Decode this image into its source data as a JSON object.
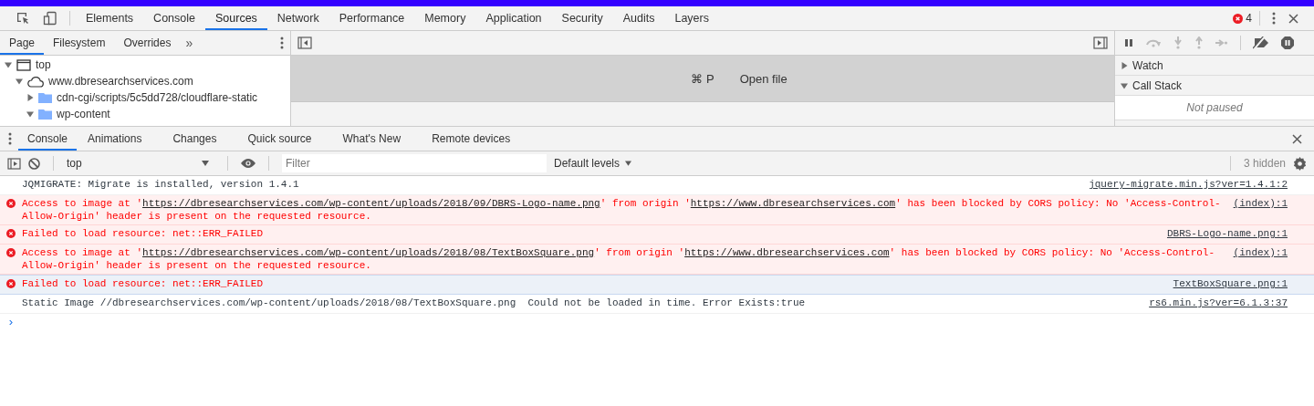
{
  "main_tabs": [
    {
      "label": "Elements",
      "selected": false
    },
    {
      "label": "Console",
      "selected": false
    },
    {
      "label": "Sources",
      "selected": true
    },
    {
      "label": "Network",
      "selected": false
    },
    {
      "label": "Performance",
      "selected": false
    },
    {
      "label": "Memory",
      "selected": false
    },
    {
      "label": "Application",
      "selected": false
    },
    {
      "label": "Security",
      "selected": false
    },
    {
      "label": "Audits",
      "selected": false
    },
    {
      "label": "Layers",
      "selected": false
    }
  ],
  "error_count": "4",
  "navigator_tabs": [
    {
      "label": "Page",
      "selected": true
    },
    {
      "label": "Filesystem",
      "selected": false
    },
    {
      "label": "Overrides",
      "selected": false
    }
  ],
  "navigator_more": "»",
  "file_tree": [
    {
      "label": "top",
      "kind": "frame",
      "expanded": true,
      "children": [
        {
          "label": "www.dbresearchservices.com",
          "kind": "domain",
          "expanded": true,
          "children": [
            {
              "label": "cdn-cgi/scripts/5c5dd728/cloudflare-static",
              "kind": "folder",
              "expanded": false
            },
            {
              "label": "wp-content",
              "kind": "folder",
              "expanded": true
            }
          ]
        }
      ]
    }
  ],
  "editor": {
    "shortcut": "⌘ P",
    "action": "Open file"
  },
  "debugger_sections": [
    {
      "label": "Watch",
      "expanded": false
    },
    {
      "label": "Call Stack",
      "expanded": true,
      "content": "Not paused"
    }
  ],
  "drawer_tabs": [
    {
      "label": "Console",
      "selected": true
    },
    {
      "label": "Animations",
      "selected": false
    },
    {
      "label": "Changes",
      "selected": false
    },
    {
      "label": "Quick source",
      "selected": false
    },
    {
      "label": "What's New",
      "selected": false
    },
    {
      "label": "Remote devices",
      "selected": false
    }
  ],
  "console_toolbar": {
    "context": "top",
    "filter_placeholder": "Filter",
    "levels": "Default levels",
    "hidden_count": "3 hidden"
  },
  "messages": [
    {
      "kind": "log",
      "selected": false,
      "parts": [
        {
          "text": "JQMIGRATE: Migrate is installed, version 1.4.1"
        }
      ],
      "source": "jquery-migrate.min.js?ver=1.4.1:2"
    },
    {
      "kind": "error",
      "selected": false,
      "parts": [
        {
          "text": "Access to image at '"
        },
        {
          "text": "https://dbresearchservices.com/wp-content/uploads/2018/09/DBRS-Logo-name.png",
          "link": true
        },
        {
          "text": "' from origin '"
        },
        {
          "text": "https://www.dbresearchservices.com",
          "link": true
        },
        {
          "text": "' has been blocked by CORS policy: No 'Access-Control-Allow-Origin' header is present on the requested resource."
        }
      ],
      "source": "(index):1"
    },
    {
      "kind": "error",
      "selected": false,
      "parts": [
        {
          "text": "Failed to load resource: net::ERR_FAILED"
        }
      ],
      "source": "DBRS-Logo-name.png:1"
    },
    {
      "kind": "error",
      "selected": false,
      "parts": [
        {
          "text": "Access to image at '"
        },
        {
          "text": "https://dbresearchservices.com/wp-content/uploads/2018/08/TextBoxSquare.png",
          "link": true
        },
        {
          "text": "' from origin '"
        },
        {
          "text": "https://www.dbresearchservices.com",
          "link": true
        },
        {
          "text": "' has been blocked by CORS policy: No 'Access-Control-Allow-Origin' header is present on the requested resource."
        }
      ],
      "source": "(index):1"
    },
    {
      "kind": "error",
      "selected": true,
      "parts": [
        {
          "text": "Failed to load resource: net::ERR_FAILED"
        }
      ],
      "source": "TextBoxSquare.png:1"
    },
    {
      "kind": "log",
      "selected": false,
      "parts": [
        {
          "text": "Static Image //dbresearchservices.com/wp-content/uploads/2018/08/TextBoxSquare.png  Could not be loaded in time. Error Exists:true"
        }
      ],
      "source": "rs6.min.js?ver=6.1.3:37"
    }
  ],
  "prompt": "›"
}
